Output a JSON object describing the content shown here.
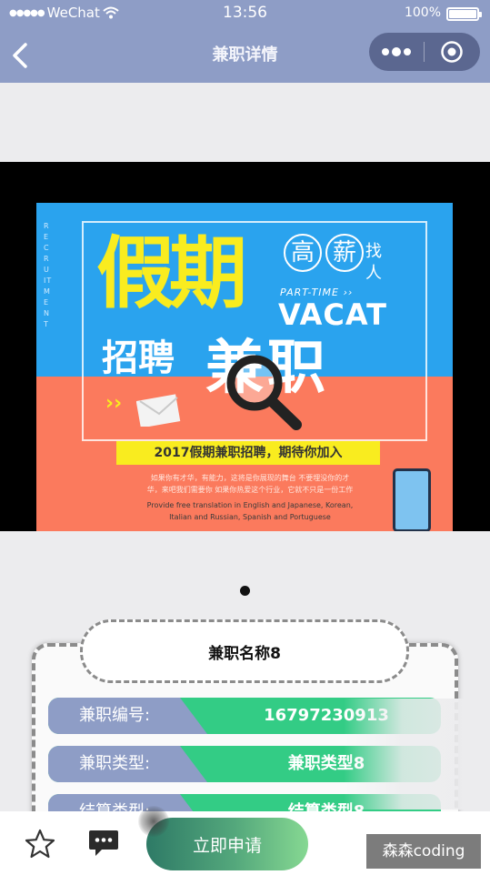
{
  "status_bar": {
    "carrier": "WeChat",
    "signal": "●●●●●",
    "time": "13:56",
    "battery": "100%"
  },
  "nav": {
    "title": "兼职详情",
    "back_icon": "chevron-left-icon",
    "menu_icon": "more-dots-icon",
    "close_icon": "target-circle-icon"
  },
  "banner": {
    "headline": "假期",
    "badge_1": "高",
    "badge_2": "薪",
    "find_text": "找人",
    "parttime_text": "PART-TIME ››",
    "vacat_text": "VACAT",
    "hire_text": "招聘",
    "partjob_text": "兼职",
    "vertical_text": "RECRUITMENT",
    "slogan": "2017假期兼职招聘，期待你加入",
    "small_text": "如果你有才华，有能力，这将是你展现的舞台 不要埋没你的才华，来吧我们需要你 如果你热爱这个行业，它就不只是一份工作",
    "english_text": "Provide free translation in English and Japanese, Korean, Italian and Russian, Spanish and Portuguese",
    "colors": {
      "top": "#2aa3ee",
      "bottom": "#fb7a5d",
      "yellow": "#f9ec1f"
    }
  },
  "indicator": {
    "current": 1,
    "total": 1
  },
  "detail": {
    "name": "兼职名称8",
    "rows": [
      {
        "label": "兼职编号:",
        "value": "16797230913"
      },
      {
        "label": "兼职类型:",
        "value": "兼职类型8"
      },
      {
        "label": "结算类型:",
        "value": "结算类型8"
      }
    ]
  },
  "bottom_bar": {
    "favorite_icon": "star-outline-icon",
    "chat_icon": "chat-bubble-icon",
    "apply_label": "立即申请"
  },
  "watermark": "森森coding",
  "theme": {
    "nav": "#8e9dc6",
    "accent_green": "#33cc85"
  }
}
